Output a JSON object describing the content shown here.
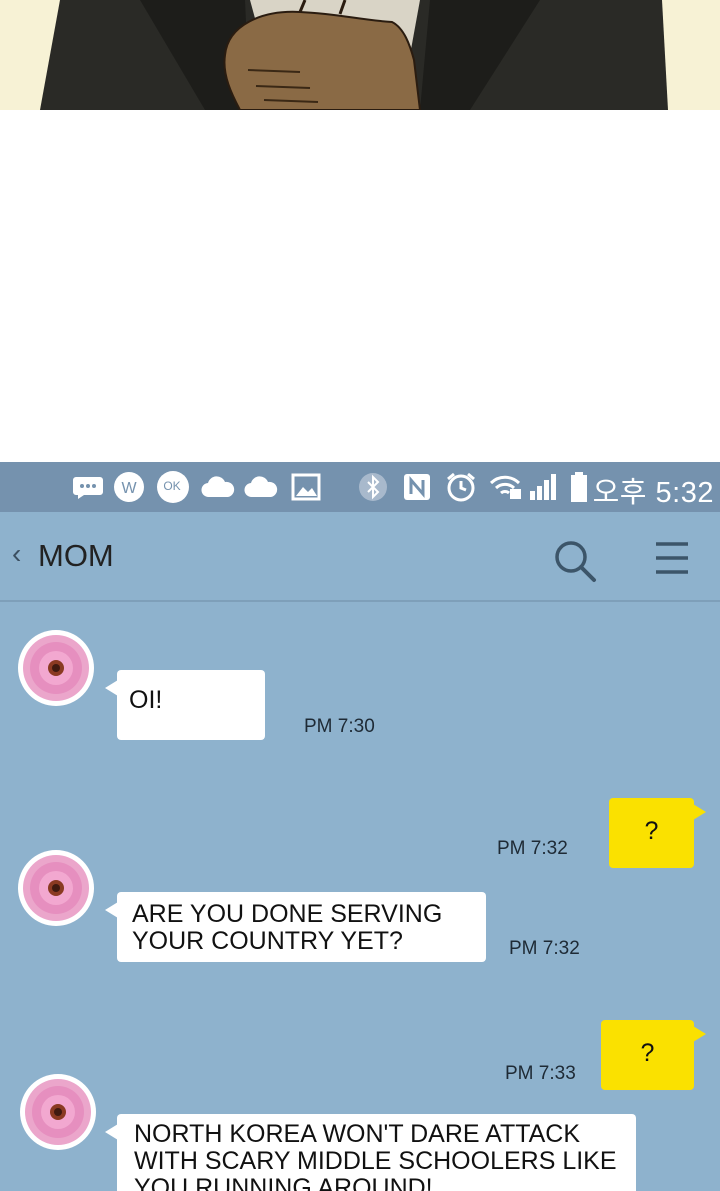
{
  "statusbar": {
    "time": "오후 5:32",
    "icons": [
      "messages-icon",
      "w-app-icon",
      "ok-cashbag-icon",
      "cloud-icon",
      "cloud-icon",
      "gallery-icon",
      "bluetooth-icon",
      "nfc-icon",
      "alarm-icon",
      "wifi-icon",
      "signal-icon",
      "battery-icon"
    ],
    "ok_icon_text": "OK",
    "w_icon_text": "W"
  },
  "chat": {
    "title": "MOM",
    "back_glyph": "‹"
  },
  "colors": {
    "chat_bg": "#8eb2cd",
    "statusbar_bg": "#7592ae",
    "my_bubble": "#fae100",
    "their_bubble": "#ffffff"
  },
  "messages": [
    {
      "from": "mom",
      "text": "OI!",
      "time": "PM 7:30"
    },
    {
      "from": "me",
      "text": "?",
      "time": "PM 7:32"
    },
    {
      "from": "mom",
      "text": "ARE YOU DONE SERVING YOUR COUNTRY YET?",
      "time": "PM 7:32"
    },
    {
      "from": "me",
      "text": "?",
      "time": "PM 7:33"
    },
    {
      "from": "mom",
      "text": "NORTH KOREA WON'T DARE ATTACK WITH SCARY MIDDLE SCHOOLERS LIKE YOU RUNNING AROUND!"
    }
  ]
}
